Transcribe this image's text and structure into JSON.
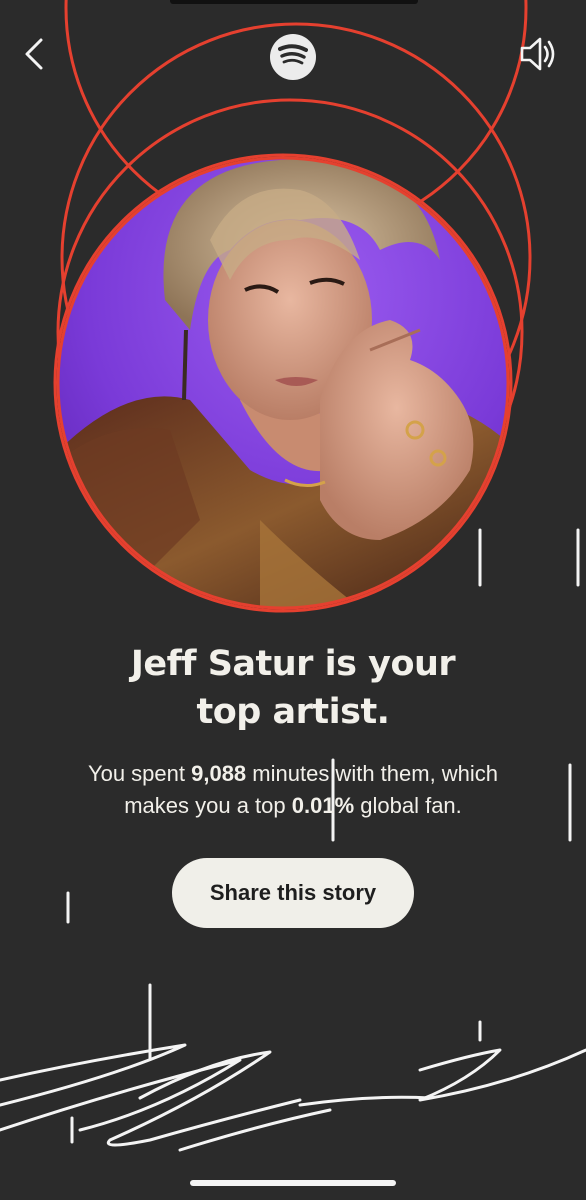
{
  "colors": {
    "background": "#2b2b2b",
    "ring_red": "#e5402f",
    "text": "#f2f0ea",
    "button_bg": "#f0efe9",
    "button_text": "#1e1e1e",
    "photo_backdrop": "#8a46e0"
  },
  "nav": {
    "back_icon": "chevron-left-icon",
    "logo_icon": "spotify-logo-icon",
    "sound_icon": "speaker-icon"
  },
  "story": {
    "headline_line1": "Jeff Satur is your",
    "headline_line2": "top artist.",
    "sub_line1_pre": "You spent ",
    "minutes": "9,088",
    "sub_line1_post": " minutes with them, which",
    "sub_line2_pre": "makes you a top ",
    "percent": "0.01%",
    "sub_line2_post": " global fan.",
    "share_label": "Share this story"
  },
  "artist_photo": {
    "description_icon": "artist-photo"
  }
}
